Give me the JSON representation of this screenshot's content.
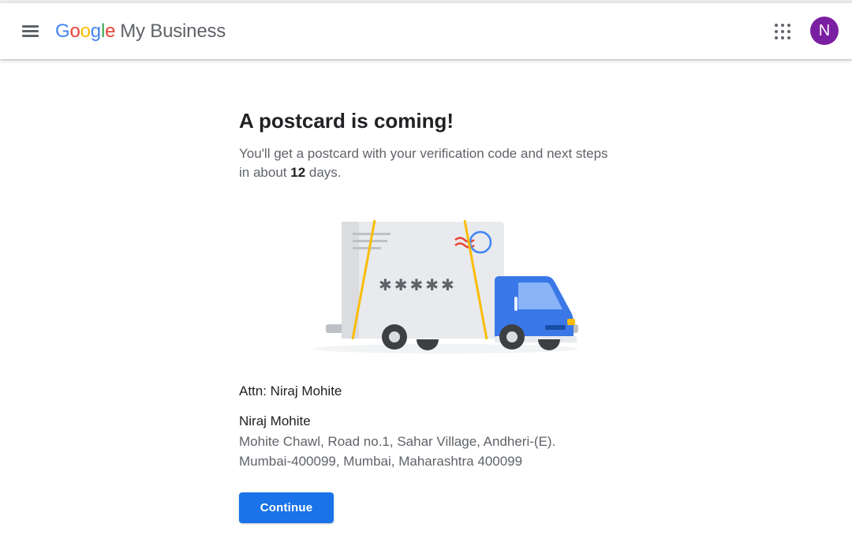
{
  "header": {
    "logo_letters": [
      "G",
      "o",
      "o",
      "g",
      "l",
      "e"
    ],
    "product_name": "My Business",
    "menu_icon": "hamburger-menu-icon",
    "apps_icon": "apps-grid-icon",
    "avatar_initial": "N",
    "avatar_color": "#7b1fa2"
  },
  "main": {
    "headline": "A postcard is coming!",
    "description_before": "You'll get a postcard with your verification code and next steps in about ",
    "description_days": "12",
    "description_after": " days.",
    "illustration": {
      "icon": "delivery-truck-postcard-illustration",
      "code_mask": "✱✱✱✱✱"
    },
    "attn": "Attn: Niraj Mohite",
    "recipient_name": "Niraj Mohite",
    "address_line1": "Mohite Chawl, Road no.1, Sahar Village, Andheri-(E).",
    "address_line2": "Mumbai-400099, Mumbai, Maharashtra 400099",
    "continue_label": "Continue"
  },
  "colors": {
    "primary": "#1a73e8",
    "truck_blue": "#3b78e7",
    "strap_yellow": "#fbbc05",
    "stamp_red": "#ea4335",
    "text_dark": "#202124",
    "text_muted": "#5f6368"
  }
}
